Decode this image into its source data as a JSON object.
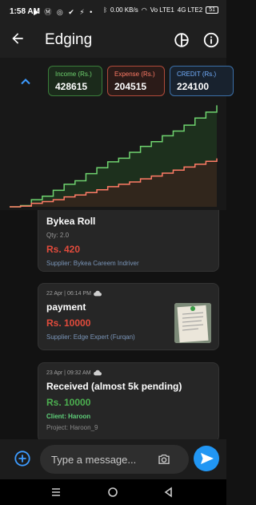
{
  "status_bar": {
    "time": "1:58 AM",
    "notification_icons": "▶ Ⓜ ◎ ✔ ⚡ •",
    "network_speed": "0.00 KB/s",
    "signal_1": "Vo LTE1",
    "signal_2": "4G LTE2",
    "battery": "51"
  },
  "app_bar": {
    "title": "Edging"
  },
  "summary": {
    "income_label": "Income (Rs.)",
    "income_value": "428615",
    "expense_label": "Expense (Rs.)",
    "expense_value": "204515",
    "credit_label": "CREDIT (Rs.)",
    "credit_value": "224100"
  },
  "messages": [
    {
      "title": "Bykea Roll",
      "qty": "Qty: 2.0",
      "amount": "Rs. 420",
      "supplier": "Supplier: Bykea Careem Indriver"
    },
    {
      "meta": "22 Apr | 06:14 PM",
      "title": "payment",
      "amount": "Rs. 10000",
      "supplier": "Supplier: Edge Expert (Furqan)"
    },
    {
      "meta": "23 Apr | 09:32 AM",
      "title": "Received (almost 5k pending)",
      "amount": "Rs. 10000",
      "client": "Client: Haroon",
      "project": "Project: Haroon_9"
    }
  ],
  "composer": {
    "placeholder": "Type a message..."
  },
  "colors": {
    "income": "#6fd36f",
    "expense": "#ff7b66",
    "credit": "#72aefc",
    "send": "#2196f3"
  },
  "chart_data": {
    "type": "area",
    "title": "",
    "xlabel": "",
    "ylabel": "",
    "legend": "none",
    "grid": false,
    "series": [
      {
        "name": "Income (Rs.)",
        "values": [
          0,
          5000,
          30000,
          45000,
          70000,
          95000,
          110000,
          140000,
          165000,
          190000,
          205000,
          230000,
          255000,
          275000,
          300000,
          320000,
          345000,
          375000,
          400000,
          428615
        ]
      },
      {
        "name": "Expense (Rs.)",
        "values": [
          0,
          3000,
          15000,
          22000,
          30000,
          42000,
          50000,
          60000,
          72000,
          85000,
          95000,
          105000,
          118000,
          130000,
          142000,
          155000,
          168000,
          180000,
          192000,
          204515
        ]
      }
    ],
    "ylim": [
      0,
      440000
    ]
  }
}
